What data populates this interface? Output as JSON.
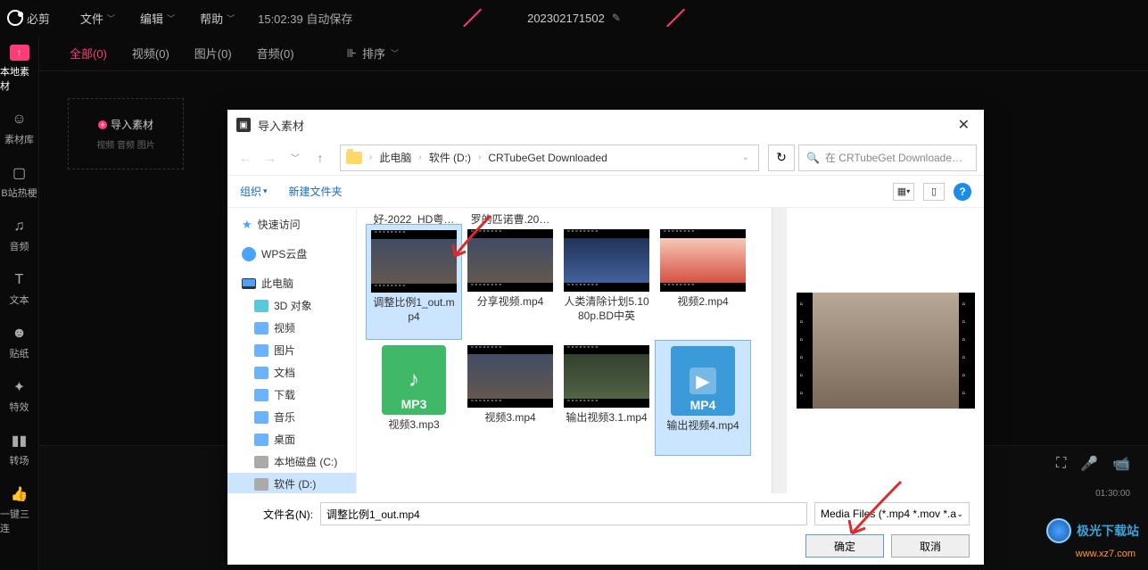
{
  "app": {
    "name": "必剪"
  },
  "menu": {
    "file": "文件",
    "edit": "编辑",
    "help": "帮助",
    "autosave": "15:02:39 自动保存"
  },
  "project": {
    "name": "202302171502"
  },
  "sidebar": {
    "items": [
      {
        "label": "本地素材"
      },
      {
        "label": "素材库"
      },
      {
        "label": "B站热梗"
      },
      {
        "label": "音频"
      },
      {
        "label": "文本"
      },
      {
        "label": "贴纸"
      },
      {
        "label": "特效"
      },
      {
        "label": "转场"
      },
      {
        "label": "一键三连"
      }
    ]
  },
  "tabs": {
    "items": [
      "全部(0)",
      "视频(0)",
      "图片(0)",
      "音频(0)"
    ],
    "sort": "排序"
  },
  "import_box": {
    "label": "导入素材",
    "sub": "视频 音频 图片"
  },
  "timeline": {
    "marker": "01:30:00"
  },
  "dialog": {
    "title": "导入素材",
    "breadcrumb": [
      "此电脑",
      "软件 (D:)",
      "CRTubeGet Downloaded"
    ],
    "refresh": "↻",
    "search_placeholder": "在 CRTubeGet Downloade…",
    "toolbar": {
      "organize": "组织",
      "newfolder": "新建文件夹"
    },
    "tree": {
      "quick": "快速访问",
      "wps": "WPS云盘",
      "thispc": "此电脑",
      "obj3d": "3D 对象",
      "video": "视频",
      "picture": "图片",
      "doc": "文档",
      "download": "下载",
      "music": "音乐",
      "desktop": "桌面",
      "diskc": "本地磁盘 (C:)",
      "diskd": "软件 (D:)"
    },
    "partial_row": [
      "好-2022_HD粤…",
      "罗的匹诺曹.20…"
    ],
    "files": [
      {
        "name": "调整比例1_out.mp4",
        "type": "video",
        "selected": true
      },
      {
        "name": "分享视频.mp4",
        "type": "video"
      },
      {
        "name": "人类清除计划5.1080p.BD中英",
        "type": "video"
      },
      {
        "name": "视频2.mp4",
        "type": "video"
      },
      {
        "name": "视频3.mp3",
        "type": "mp3"
      },
      {
        "name": "视频3.mp4",
        "type": "video"
      },
      {
        "name": "输出视频3.1.mp4",
        "type": "video"
      },
      {
        "name": "输出视频4.mp4",
        "type": "mp4",
        "selected": true
      }
    ],
    "footer": {
      "fname_label": "文件名(N):",
      "fname_value": "调整比例1_out.mp4",
      "ftype": "Media Files (*.mp4 *.mov *.a",
      "ok": "确定",
      "cancel": "取消"
    }
  },
  "watermark": {
    "name": "极光下载站",
    "url": "www.xz7.com"
  }
}
